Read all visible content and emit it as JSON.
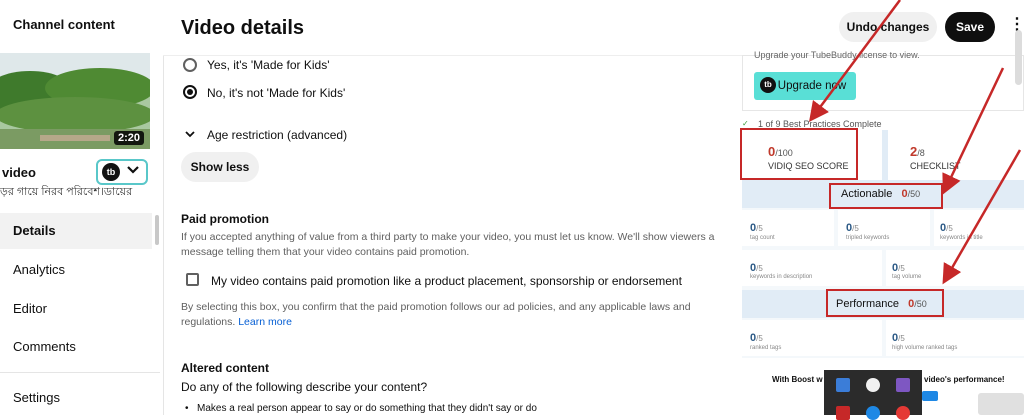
{
  "sidebar": {
    "title": "Channel content",
    "thumbnail_duration": "2:20",
    "video_title": "video",
    "video_subtitle": "ড়র গায়ে নিরব পরিবেশ।ডায়ের",
    "nav_items": [
      {
        "label": "Details",
        "active": true
      },
      {
        "label": "Analytics",
        "active": false
      },
      {
        "label": "Editor",
        "active": false
      },
      {
        "label": "Comments",
        "active": false
      }
    ],
    "settings_label": "Settings"
  },
  "header": {
    "title": "Video details",
    "undo_label": "Undo changes",
    "save_label": "Save"
  },
  "audience": {
    "option_yes": "Yes, it's 'Made for Kids'",
    "option_no": "No, it's not 'Made for Kids'",
    "selected": "no"
  },
  "age_restriction": {
    "label": "Age restriction (advanced)"
  },
  "show_less_label": "Show less",
  "paid_promotion": {
    "title": "Paid promotion",
    "description": "If you accepted anything of value from a third party to make your video, you must let us know. We'll show viewers a message telling them that your video contains paid promotion.",
    "checkbox_label": "My video contains paid promotion like a product placement, sponsorship or endorsement",
    "note": "By selecting this box, you confirm that the paid promotion follows our ad policies, and any applicable laws and regulations.",
    "learn_more": "Learn more"
  },
  "altered_content": {
    "title": "Altered content",
    "question": "Do any of the following describe your content?",
    "bullet1": "Makes a real person appear to say or do something that they didn't say or do"
  },
  "tubebuddy": {
    "upgrade_text": "Upgrade your TubeBuddy license to view.",
    "upgrade_button": "Upgrade now",
    "best_practices": "1 of 9 Best Practices Complete",
    "seo_score": {
      "value": "0",
      "max": "/100",
      "label": "VIDIQ SEO SCORE"
    },
    "checklist": {
      "value": "2",
      "max": "/8",
      "label": "CHECKLIST"
    },
    "actionable": {
      "label": "Actionable",
      "value": "0",
      "max": "/50"
    },
    "actionable_cells": [
      {
        "value": "0",
        "max": "/5",
        "label": "tag count"
      },
      {
        "value": "0",
        "max": "/5",
        "label": "tripled keywords"
      },
      {
        "value": "0",
        "max": "/5",
        "label": "keywords in title"
      },
      {
        "value": "0",
        "max": "/5",
        "label": "keywords in description"
      },
      {
        "value": "0",
        "max": "/5",
        "label": "tag volume"
      }
    ],
    "performance": {
      "label": "Performance",
      "value": "0",
      "max": "/50"
    },
    "performance_cells": [
      {
        "value": "0",
        "max": "/5",
        "label": "ranked tags"
      },
      {
        "value": "0",
        "max": "/5",
        "label": "high volume ranked tags"
      }
    ],
    "boost_text_left": "With Boost w",
    "boost_text_right": "video's performance!"
  },
  "colors": {
    "accent_red": "#c62828",
    "tubebuddy_teal": "#59dfd6",
    "youtube_black": "#0f0f0f"
  }
}
